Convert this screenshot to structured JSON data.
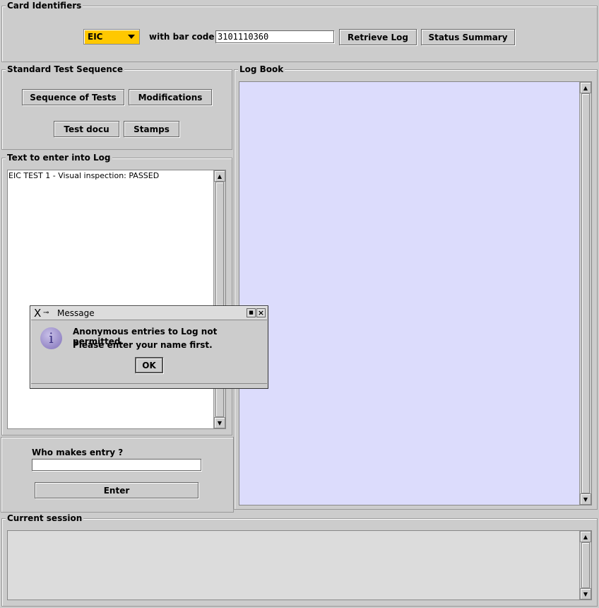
{
  "card_identifiers": {
    "title": "Card Identifiers",
    "card_type": "EIC",
    "bar_code_label": "with bar code",
    "bar_code_value": "3101110360",
    "retrieve_log": "Retrieve Log",
    "status_summary": "Status Summary",
    "accent": "#ffc800"
  },
  "standard_test_sequence": {
    "title": "Standard Test Sequence",
    "buttons": [
      "Sequence of Tests",
      "Modifications",
      "Test docu",
      "Stamps"
    ]
  },
  "log_book": {
    "title": "Log Book",
    "background": "#dcdcfc"
  },
  "text_entry": {
    "title": "Text to enter into Log",
    "value": "EIC TEST 1 - Visual inspection: PASSED"
  },
  "who": {
    "label": "Who makes entry ?",
    "value": "",
    "enter": "Enter"
  },
  "current_session": {
    "title": "Current session"
  },
  "dialog": {
    "title": "Message",
    "icon": "info-icon",
    "line1": "Anonymous entries to Log not permitted.",
    "line2": "Please enter your name first.",
    "ok": "OK"
  }
}
